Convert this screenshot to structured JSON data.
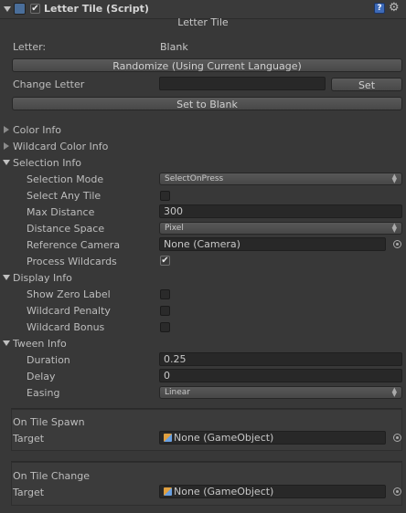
{
  "component": {
    "title": "Letter Tile (Script)",
    "enabled": true,
    "script_title": "Letter Tile"
  },
  "letter": {
    "label": "Letter:",
    "value": "Blank"
  },
  "randomize_button": "Randomize (Using Current Language)",
  "change_letter": {
    "label": "Change Letter",
    "value": "",
    "set_button": "Set"
  },
  "set_blank_button": "Set to Blank",
  "sections": {
    "color_info": "Color Info",
    "wildcard_color_info": "Wildcard Color Info",
    "selection_info": "Selection Info",
    "display_info": "Display Info",
    "tween_info": "Tween Info"
  },
  "selection": {
    "mode_label": "Selection Mode",
    "mode_value": "SelectOnPress",
    "any_tile_label": "Select Any Tile",
    "any_tile": false,
    "max_distance_label": "Max Distance",
    "max_distance": "300",
    "distance_space_label": "Distance Space",
    "distance_space": "Pixel",
    "ref_camera_label": "Reference Camera",
    "ref_camera": "None (Camera)",
    "process_wildcards_label": "Process Wildcards",
    "process_wildcards": true
  },
  "display": {
    "zero_label": "Show Zero Label",
    "zero": false,
    "penalty_label": "Wildcard Penalty",
    "penalty": false,
    "bonus_label": "Wildcard Bonus",
    "bonus": false
  },
  "tween": {
    "duration_label": "Duration",
    "duration": "0.25",
    "delay_label": "Delay",
    "delay": "0",
    "easing_label": "Easing",
    "easing": "Linear"
  },
  "events": {
    "spawn_title": "On Tile Spawn",
    "spawn_target_label": "Target",
    "spawn_target": "None (GameObject)",
    "change_title": "On Tile Change",
    "change_target_label": "Target",
    "change_target": "None (GameObject)"
  },
  "colors": {
    "background": "#383838",
    "field": "#282828",
    "text": "#bdbdbd"
  }
}
